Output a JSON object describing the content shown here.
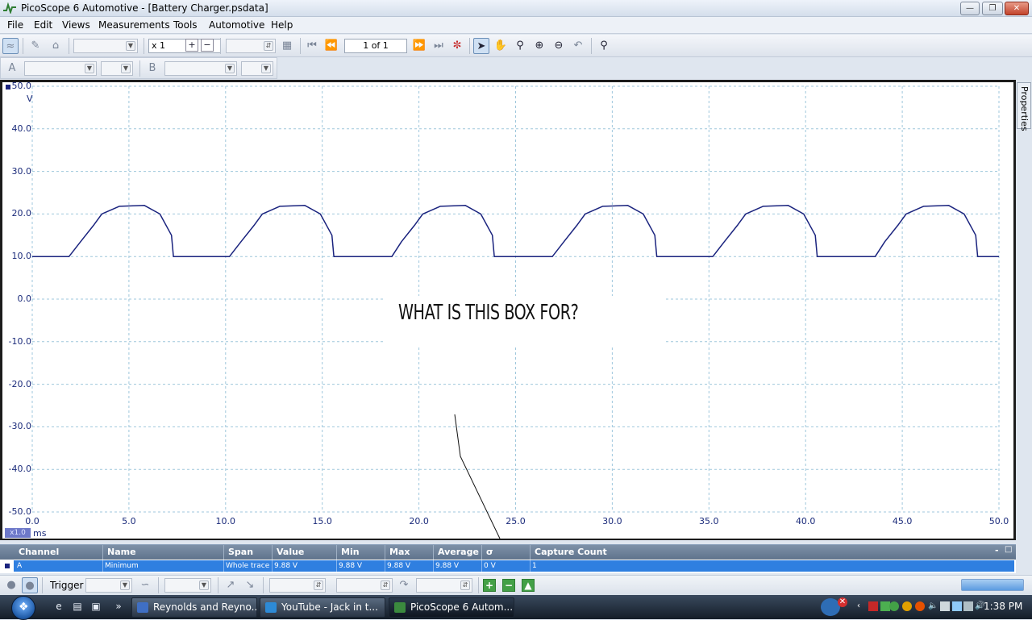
{
  "window": {
    "title": "PicoScope 6 Automotive - [Battery Charger.psdata]"
  },
  "menu": [
    "File",
    "Edit",
    "Views",
    "Measurements",
    "Tools",
    "Automotive",
    "Help"
  ],
  "toolbar": {
    "zoom_factor": "x 1",
    "page_indicator": "1 of 1"
  },
  "scope": {
    "y_unit": "V",
    "x_unit": "ms",
    "zoom_badge": "x1.0",
    "y_ticks": [
      "50.0",
      "40.0",
      "30.0",
      "20.0",
      "10.0",
      "0.0",
      "-10.0",
      "-20.0",
      "-30.0",
      "-40.0",
      "-50.0"
    ],
    "x_ticks": [
      "0.0",
      "5.0",
      "10.0",
      "15.0",
      "20.0",
      "25.0",
      "30.0",
      "35.0",
      "40.0",
      "45.0",
      "50.0"
    ],
    "trace_color": "#1a237e",
    "grid_color": "#9fc7dc"
  },
  "chart_data": {
    "type": "line",
    "xlabel": "ms",
    "ylabel": "V",
    "xlim": [
      0,
      50
    ],
    "ylim": [
      -50,
      50
    ],
    "grid": true,
    "series": [
      {
        "name": "A",
        "period_ms": 8.333,
        "points": [
          [
            0.0,
            10.0
          ],
          [
            1.9,
            10.0
          ],
          [
            2.5,
            13.5
          ],
          [
            3.2,
            17.5
          ],
          [
            3.6,
            20.0
          ],
          [
            4.5,
            21.8
          ],
          [
            5.8,
            22.0
          ],
          [
            6.6,
            20.0
          ],
          [
            7.2,
            15.0
          ],
          [
            7.3,
            10.0
          ],
          [
            10.2,
            10.0
          ],
          [
            10.8,
            13.5
          ],
          [
            11.5,
            17.5
          ],
          [
            11.9,
            20.0
          ],
          [
            12.8,
            21.8
          ],
          [
            14.1,
            22.0
          ],
          [
            14.9,
            20.0
          ],
          [
            15.5,
            15.0
          ],
          [
            15.6,
            10.0
          ],
          [
            18.6,
            10.0
          ],
          [
            19.1,
            13.5
          ],
          [
            19.8,
            17.5
          ],
          [
            20.2,
            20.0
          ],
          [
            21.1,
            21.8
          ],
          [
            22.4,
            22.0
          ],
          [
            23.2,
            20.0
          ],
          [
            23.8,
            15.0
          ],
          [
            23.9,
            10.0
          ],
          [
            26.9,
            10.0
          ],
          [
            27.5,
            13.5
          ],
          [
            28.2,
            17.5
          ],
          [
            28.6,
            20.0
          ],
          [
            29.5,
            21.8
          ],
          [
            30.8,
            22.0
          ],
          [
            31.6,
            20.0
          ],
          [
            32.2,
            15.0
          ],
          [
            32.3,
            10.0
          ],
          [
            35.2,
            10.0
          ],
          [
            35.8,
            13.5
          ],
          [
            36.5,
            17.5
          ],
          [
            36.9,
            20.0
          ],
          [
            37.8,
            21.8
          ],
          [
            39.1,
            22.0
          ],
          [
            39.9,
            20.0
          ],
          [
            40.5,
            15.0
          ],
          [
            40.6,
            10.0
          ],
          [
            43.6,
            10.0
          ],
          [
            44.1,
            13.5
          ],
          [
            44.8,
            17.5
          ],
          [
            45.2,
            20.0
          ],
          [
            46.1,
            21.8
          ],
          [
            47.4,
            22.0
          ],
          [
            48.2,
            20.0
          ],
          [
            48.8,
            15.0
          ],
          [
            48.9,
            10.0
          ],
          [
            50.0,
            10.0
          ]
        ]
      }
    ]
  },
  "annotation": {
    "text": "WHAT IS THIS BOX FOR?"
  },
  "properties_tab": "Properties",
  "measurements": {
    "columns": [
      "Channel",
      "Name",
      "Span",
      "Value",
      "Min",
      "Max",
      "Average",
      "σ",
      "Capture Count"
    ],
    "rows": [
      [
        "A",
        "Minimum",
        "Whole trace",
        "9.88 V",
        "9.88 V",
        "9.88 V",
        "9.88 V",
        "0 V",
        "1"
      ]
    ]
  },
  "triggerbar": {
    "label": "Trigger"
  },
  "taskbar": {
    "tasks": [
      "Reynolds and Reyno...",
      "YouTube - Jack in t...",
      "PicoScope 6 Autom..."
    ],
    "clock": "1:38 PM"
  }
}
